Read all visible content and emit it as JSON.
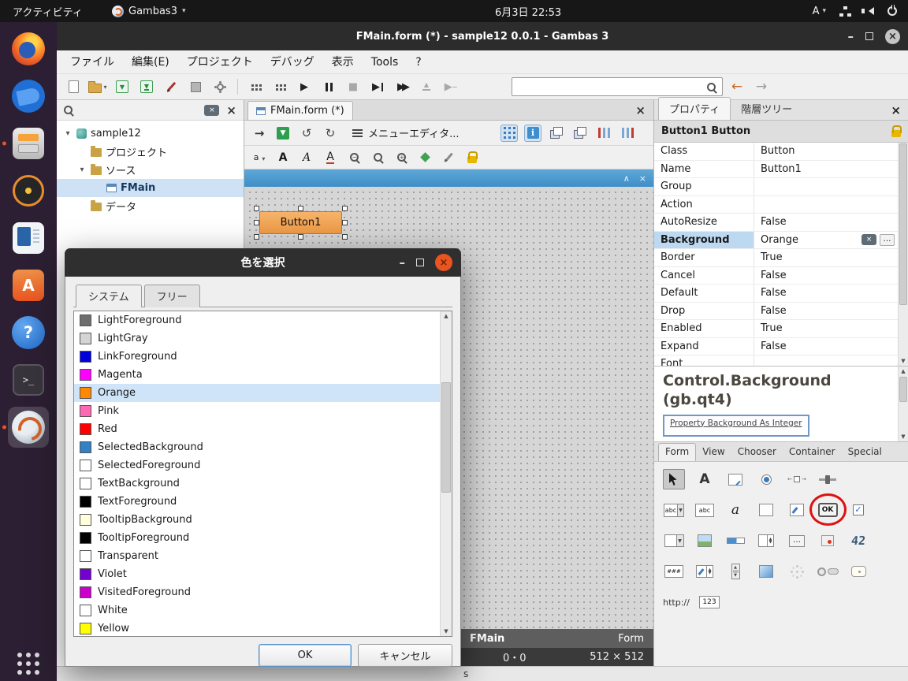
{
  "top_bar": {
    "activities": "アクティビティ",
    "app_name": "Gambas3",
    "clock": "6月3日 22:53",
    "input_indicator": "A"
  },
  "window": {
    "title": "FMain.form (*) - sample12 0.0.1 - Gambas 3",
    "status_text": "s"
  },
  "menu": {
    "items": [
      {
        "label": "ファイル"
      },
      {
        "label": "編集(E)"
      },
      {
        "label": "プロジェクト"
      },
      {
        "label": "デバッグ"
      },
      {
        "label": "表示"
      },
      {
        "label": "Tools"
      },
      {
        "label": "?"
      }
    ]
  },
  "project_tree": {
    "root": "sample12",
    "nodes": [
      {
        "label": "プロジェクト",
        "type": "folder",
        "depth": 1
      },
      {
        "label": "ソース",
        "type": "folder",
        "depth": 1,
        "expanded": true
      },
      {
        "label": "FMain",
        "type": "form",
        "depth": 2,
        "selected": true
      },
      {
        "label": "データ",
        "type": "folder",
        "depth": 1
      }
    ]
  },
  "editor": {
    "tab_label": "FMain.form (*)",
    "menu_editor_label": "メニューエディタ...",
    "format": {
      "small": "a",
      "bold": "A",
      "italic": "A",
      "underline": "A"
    },
    "form": {
      "button_label": "Button1"
    },
    "footer": {
      "name": "FMain",
      "type": "Form",
      "position": "0・0",
      "size": "512 × 512"
    }
  },
  "right_panel": {
    "tabs": [
      {
        "label": "プロパティ",
        "active": true
      },
      {
        "label": "階層ツリー"
      }
    ],
    "object_header": "Button1 Button",
    "properties": [
      {
        "name": "Class",
        "value": "Button"
      },
      {
        "name": "Name",
        "value": "Button1"
      },
      {
        "name": "Group",
        "value": ""
      },
      {
        "name": "Action",
        "value": ""
      },
      {
        "name": "AutoResize",
        "value": "False"
      },
      {
        "name": "Background",
        "value": "Orange",
        "selected": true
      },
      {
        "name": "Border",
        "value": "True"
      },
      {
        "name": "Cancel",
        "value": "False"
      },
      {
        "name": "Default",
        "value": "False"
      },
      {
        "name": "Drop",
        "value": "False"
      },
      {
        "name": "Enabled",
        "value": "True"
      },
      {
        "name": "Expand",
        "value": "False"
      },
      {
        "name": "Font",
        "value": ""
      }
    ],
    "help": {
      "title_line1": "Control.Background",
      "title_line2": "(gb.qt4)",
      "signature": "Property Background As Integer"
    },
    "toolbox_tabs": [
      {
        "label": "Form",
        "active": true
      },
      {
        "label": "View"
      },
      {
        "label": "Chooser"
      },
      {
        "label": "Container"
      },
      {
        "label": "Special"
      }
    ],
    "toolbox": {
      "label_a": "A",
      "abc_combo": "abc",
      "abc_box": "abc",
      "italic_a": "a",
      "ok_button": "OK",
      "lcd": "42",
      "mask": "###",
      "url": "http://",
      "number": "123"
    }
  },
  "color_dialog": {
    "title": "色を選択",
    "tabs": [
      {
        "label": "システム",
        "active": true
      },
      {
        "label": "フリー"
      }
    ],
    "ok_label": "OK",
    "cancel_label": "キャンセル",
    "colors": [
      {
        "name": "LightForeground",
        "hex": "#6e6e6e"
      },
      {
        "name": "LightGray",
        "hex": "#d4d4d4"
      },
      {
        "name": "LinkForeground",
        "hex": "#0000dd"
      },
      {
        "name": "Magenta",
        "hex": "#ff00ff"
      },
      {
        "name": "Orange",
        "hex": "#ff8800",
        "selected": true
      },
      {
        "name": "Pink",
        "hex": "#ff69b4"
      },
      {
        "name": "Red",
        "hex": "#ff0000"
      },
      {
        "name": "SelectedBackground",
        "hex": "#3380c4"
      },
      {
        "name": "SelectedForeground",
        "hex": "#ffffff"
      },
      {
        "name": "TextBackground",
        "hex": "#ffffff"
      },
      {
        "name": "TextForeground",
        "hex": "#000000"
      },
      {
        "name": "TooltipBackground",
        "hex": "#ffffdc"
      },
      {
        "name": "TooltipForeground",
        "hex": "#000000"
      },
      {
        "name": "Transparent",
        "hex": "#ffffff"
      },
      {
        "name": "Violet",
        "hex": "#7300cf"
      },
      {
        "name": "VisitedForeground",
        "hex": "#cc00cc"
      },
      {
        "name": "White",
        "hex": "#ffffff"
      },
      {
        "name": "Yellow",
        "hex": "#ffff00"
      }
    ]
  }
}
